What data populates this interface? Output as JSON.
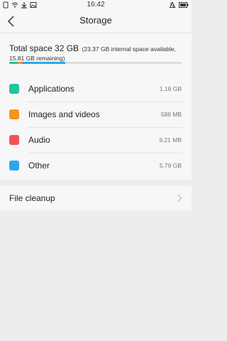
{
  "status_bar": {
    "time": "16:42",
    "left_icons": [
      "sim-icon",
      "wifi-icon",
      "download-icon",
      "image-icon"
    ],
    "right_icons": [
      "silent-icon",
      "battery-icon"
    ]
  },
  "header": {
    "title": "Storage",
    "back_icon": "chevron-left-icon"
  },
  "summary": {
    "total": "Total space 32 GB",
    "detail": "(23.37 GB internal space available, 15.81 GB remaining)",
    "usage_bar": {
      "segments": [
        {
          "name": "Applications",
          "color": "#1fc6a0",
          "value_gb": 1.18
        },
        {
          "name": "Images and videos",
          "color": "#f5951d",
          "value_gb": 0.588
        },
        {
          "name": "Audio",
          "color": "#f55454",
          "value_gb": 0.00921
        },
        {
          "name": "Other",
          "color": "#2aa8ef",
          "value_gb": 5.79
        }
      ],
      "total_gb": 23.37
    }
  },
  "categories": [
    {
      "label": "Applications",
      "size": "1.18 GB",
      "color": "#1fc6a0"
    },
    {
      "label": "Images and videos",
      "size": "588 MB",
      "color": "#f5951d"
    },
    {
      "label": "Audio",
      "size": "9.21 MB",
      "color": "#f55454"
    },
    {
      "label": "Other",
      "size": "5.79 GB",
      "color": "#2aa8ef"
    }
  ],
  "cleanup": {
    "label": "File cleanup",
    "chevron_icon": "chevron-right-icon"
  }
}
